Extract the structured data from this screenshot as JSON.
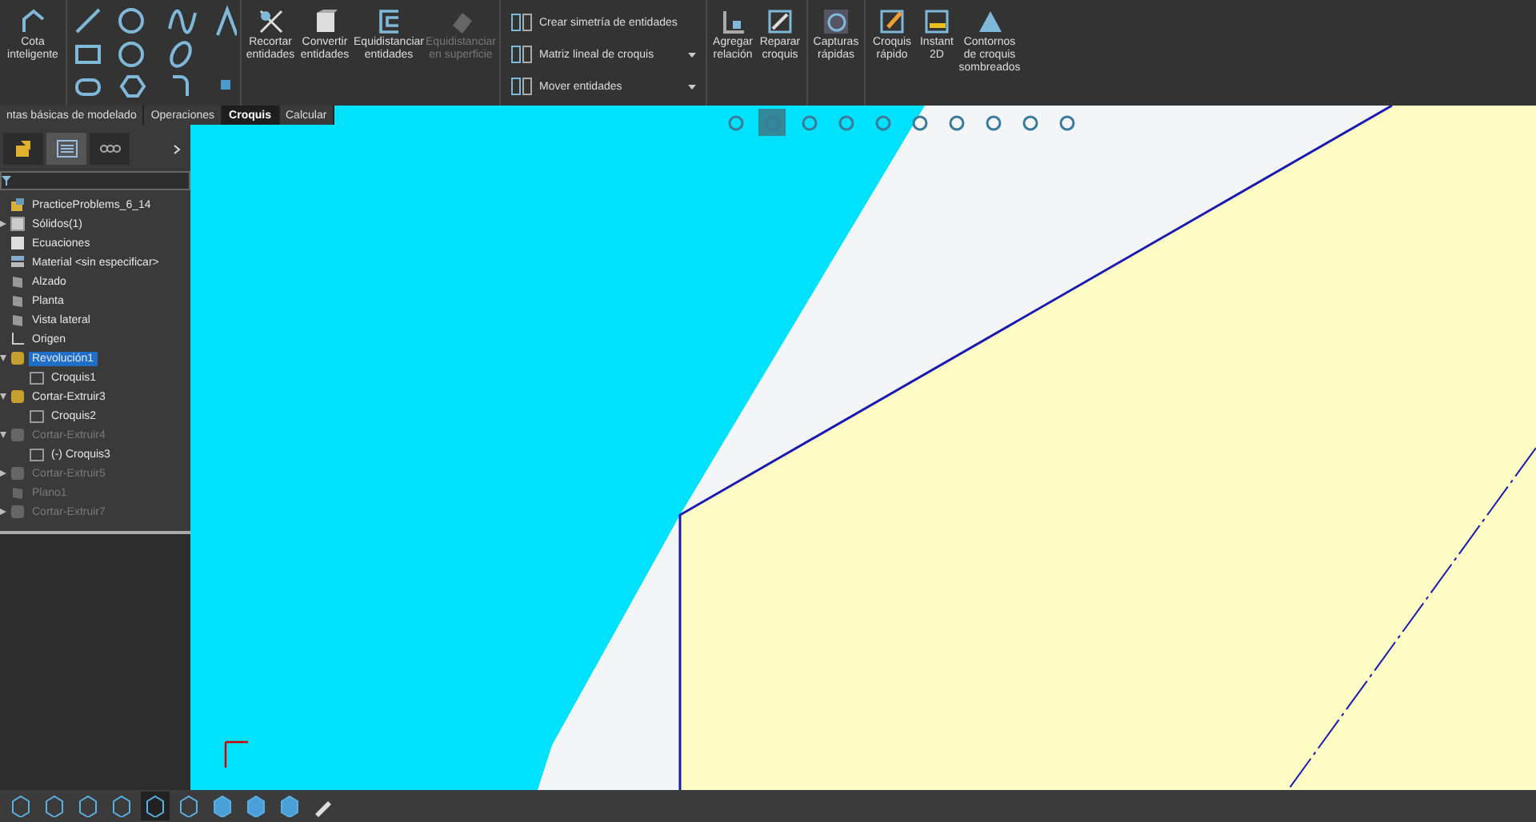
{
  "ribbon": {
    "big_buttons": [
      {
        "label": "Cota inteligente",
        "kind": "dimension",
        "disabled": false
      },
      {
        "label": "Recortar entidades",
        "kind": "trim",
        "disabled": false
      },
      {
        "label": "Convertir entidades",
        "kind": "convert",
        "disabled": false
      },
      {
        "label": "Equidistanciar entidades",
        "kind": "offset",
        "disabled": false
      },
      {
        "label": "Equidistanciar en superficie",
        "kind": "surface",
        "disabled": true
      }
    ],
    "list_buttons": [
      {
        "label": "Crear simetría de entidades",
        "dropdown": false
      },
      {
        "label": "Matriz lineal de croquis",
        "dropdown": true
      },
      {
        "label": "Mover entidades",
        "dropdown": true
      }
    ],
    "right_buttons": [
      {
        "label": "Agregar relación",
        "kind": "relation"
      },
      {
        "label": "Reparar croquis",
        "kind": "repair"
      },
      {
        "label": "Capturas rápidas",
        "kind": "snap"
      },
      {
        "label": "Croquis rápido",
        "kind": "quick"
      },
      {
        "label": "Instant 2D",
        "kind": "instant"
      },
      {
        "label": "Contornos de croquis sombreados",
        "kind": "shaded"
      }
    ]
  },
  "tabs": [
    {
      "label": "ntas básicas de modelado",
      "selected": false
    },
    {
      "label": "Operaciones",
      "selected": false
    },
    {
      "label": "Croquis",
      "selected": true
    },
    {
      "label": "Calcular",
      "selected": false
    }
  ],
  "tree": [
    {
      "label": "PracticeProblems_6_14",
      "kind": "part",
      "selected": false,
      "suppressed": false
    },
    {
      "label": "Sólidos(1)",
      "kind": "folder",
      "selected": false,
      "suppressed": false,
      "expanded": false
    },
    {
      "label": "Ecuaciones",
      "kind": "equation",
      "selected": false,
      "suppressed": false
    },
    {
      "label": "Material <sin especificar>",
      "kind": "material",
      "selected": false,
      "suppressed": false
    },
    {
      "label": "Alzado",
      "kind": "plane",
      "selected": false,
      "suppressed": false
    },
    {
      "label": "Planta",
      "kind": "plane",
      "selected": false,
      "suppressed": false
    },
    {
      "label": "Vista lateral",
      "kind": "plane",
      "selected": false,
      "suppressed": false
    },
    {
      "label": "Origen",
      "kind": "origin",
      "selected": false,
      "suppressed": false
    },
    {
      "label": "Revolución1",
      "kind": "feature",
      "selected": true,
      "suppressed": false,
      "expanded": true,
      "children": [
        {
          "label": "Croquis1",
          "kind": "sketch",
          "selected": false,
          "suppressed": false
        }
      ]
    },
    {
      "label": "Cortar-Extruir3",
      "kind": "feature",
      "selected": false,
      "suppressed": false,
      "expanded": true,
      "children": [
        {
          "label": "Croquis2",
          "kind": "sketch",
          "selected": false,
          "suppressed": false
        }
      ]
    },
    {
      "label": "Cortar-Extruir4",
      "kind": "feature",
      "selected": false,
      "suppressed": true,
      "expanded": true,
      "children": [
        {
          "label": "(-) Croquis3",
          "kind": "sketch",
          "selected": false,
          "suppressed": false
        }
      ]
    },
    {
      "label": "Cortar-Extruir5",
      "kind": "feature",
      "selected": false,
      "suppressed": true,
      "expanded": false
    },
    {
      "label": "Plano1",
      "kind": "plane",
      "selected": false,
      "suppressed": true
    },
    {
      "label": "Cortar-Extruir7",
      "kind": "feature",
      "selected": false,
      "suppressed": true,
      "expanded": false
    }
  ]
}
